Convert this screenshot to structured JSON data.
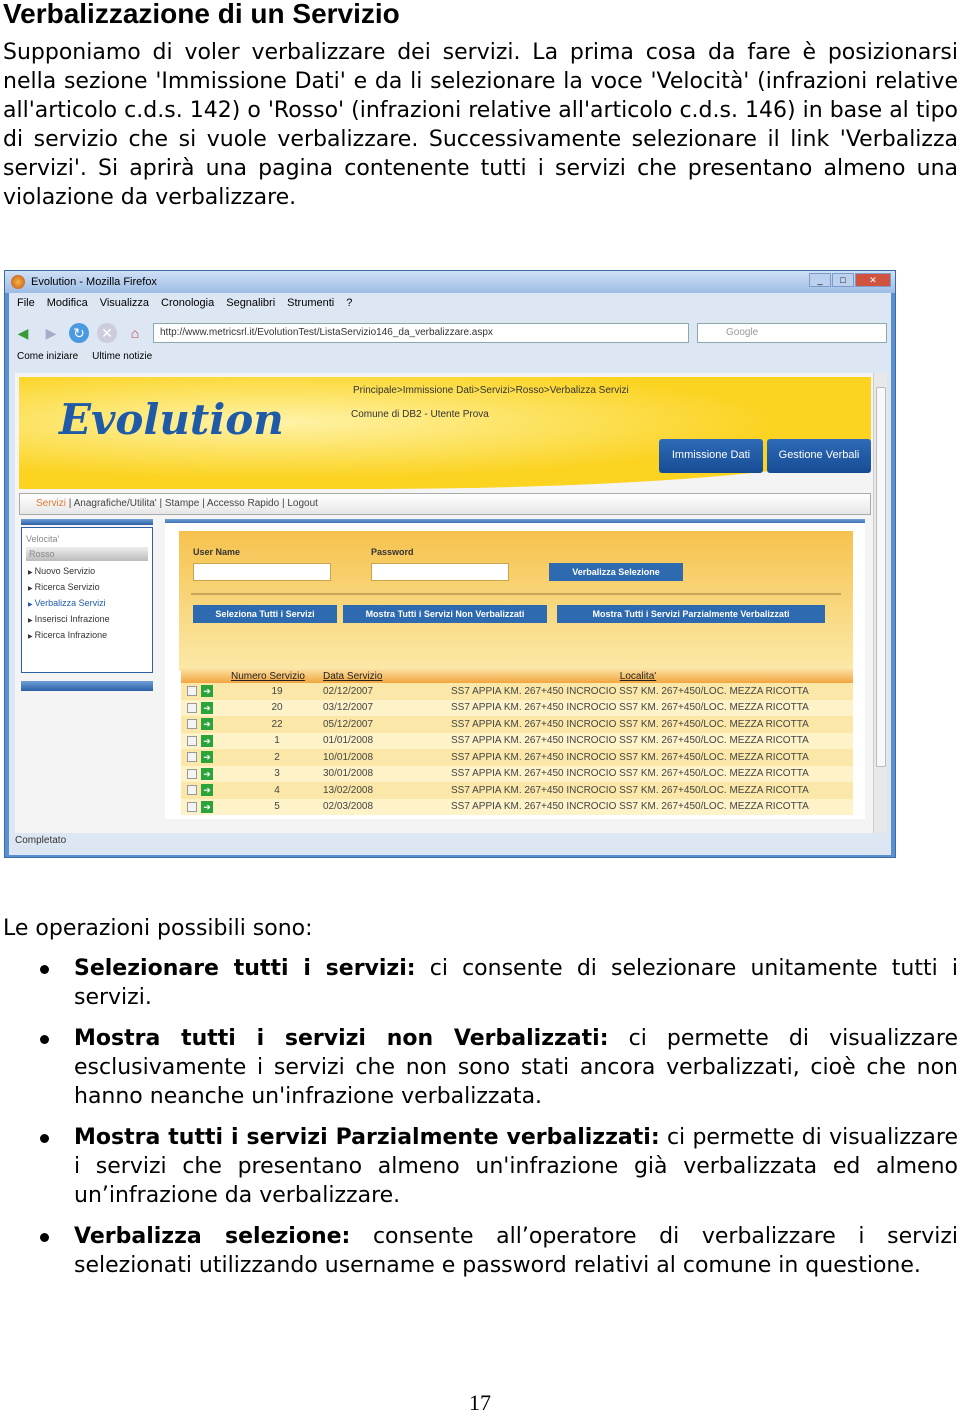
{
  "title": "Verbalizzazione di un Servizio",
  "intro": "Supponiamo di voler verbalizzare dei servizi. La prima cosa da fare è posizionarsi nella sezione 'Immissione Dati' e da li selezionare la voce 'Velocità' (infrazioni relative all'articolo c.d.s. 142) o 'Rosso' (infrazioni relative all'articolo c.d.s. 146) in base al tipo di servizio che si vuole verbalizzare. Successivamente selezionare il link 'Verbalizza servizi'. Si aprirà una pagina contenente tutti i servizi che presentano almeno una violazione da verbalizzare.",
  "screenshot": {
    "window_title": "Evolution - Mozilla Firefox",
    "menu": [
      "File",
      "Modifica",
      "Visualizza",
      "Cronologia",
      "Segnalibri",
      "Strumenti",
      "?"
    ],
    "url": "http://www.metricsrl.it/EvolutionTest/ListaServizio146_da_verbalizzare.aspx",
    "search_placeholder": "Google",
    "bookmarks": [
      "Come iniziare",
      "Ultime notizie"
    ],
    "logo": "Evolution",
    "breadcrumb": "Principale>Immissione Dati>Servizi>Rosso>Verbalizza Servizi",
    "user": "Comune di DB2 - Utente Prova",
    "header_buttons": [
      "Immissione Dati",
      "Gestione Verbali"
    ],
    "nav": [
      "Servizi",
      "Anagrafiche/Utilita'",
      "Stampe",
      "Accesso Rapido",
      "Logout"
    ],
    "sidebar": {
      "heading": "Velocita'",
      "section": "Rosso",
      "items": [
        "Nuovo Servizio",
        "Ricerca Servizio",
        "Verbalizza Servizi",
        "Inserisci Infrazione",
        "Ricerca Infrazione"
      ]
    },
    "form": {
      "user_label": "User Name",
      "password_label": "Password",
      "user_value": "",
      "password_value": "",
      "verbalizza": "Verbalizza Selezione",
      "select_all": "Seleziona Tutti i Servizi",
      "show_not": "Mostra Tutti i Servizi Non Verbalizzati",
      "show_partial": "Mostra Tutti i Servizi Parzialmente Verbalizzati"
    },
    "table": {
      "headers": [
        "Numero Servizio",
        "Data Servizio",
        "Localita'"
      ],
      "rows": [
        [
          "19",
          "02/12/2007",
          "SS7 APPIA KM. 267+450 INCROCIO SS7 KM. 267+450/LOC. MEZZA RICOTTA"
        ],
        [
          "20",
          "03/12/2007",
          "SS7 APPIA KM. 267+450 INCROCIO SS7 KM. 267+450/LOC. MEZZA RICOTTA"
        ],
        [
          "22",
          "05/12/2007",
          "SS7 APPIA KM. 267+450 INCROCIO SS7 KM. 267+450/LOC. MEZZA RICOTTA"
        ],
        [
          "1",
          "01/01/2008",
          "SS7 APPIA KM. 267+450 INCROCIO SS7 KM. 267+450/LOC. MEZZA RICOTTA"
        ],
        [
          "2",
          "10/01/2008",
          "SS7 APPIA KM. 267+450 INCROCIO SS7 KM. 267+450/LOC. MEZZA RICOTTA"
        ],
        [
          "3",
          "30/01/2008",
          "SS7 APPIA KM. 267+450 INCROCIO SS7 KM. 267+450/LOC. MEZZA RICOTTA"
        ],
        [
          "4",
          "13/02/2008",
          "SS7 APPIA KM. 267+450 INCROCIO SS7 KM. 267+450/LOC. MEZZA RICOTTA"
        ],
        [
          "5",
          "02/03/2008",
          "SS7 APPIA KM. 267+450 INCROCIO SS7 KM. 267+450/LOC. MEZZA RICOTTA"
        ]
      ]
    },
    "status": "Completato"
  },
  "ops_intro": "Le operazioni possibili sono:",
  "ops": [
    {
      "term": "Selezionare tutti i servizi:",
      "desc": " ci consente di selezionare unitamente tutti i servizi."
    },
    {
      "term": "Mostra tutti i servizi non Verbalizzati:",
      "desc": " ci permette di visualizzare esclusivamente i servizi che non sono stati ancora verbalizzati, cioè che non hanno neanche un'infrazione verbalizzata."
    },
    {
      "term": "Mostra tutti i servizi Parzialmente verbalizzati:",
      "desc": " ci permette di visualizzare i servizi che presentano almeno un'infrazione già verbalizzata ed almeno un’infrazione da verbalizzare."
    },
    {
      "term": "Verbalizza selezione:",
      "desc": " consente all’operatore di verbalizzare i servizi selezionati utilizzando username e password relativi al comune in questione."
    }
  ],
  "page_number": "17"
}
